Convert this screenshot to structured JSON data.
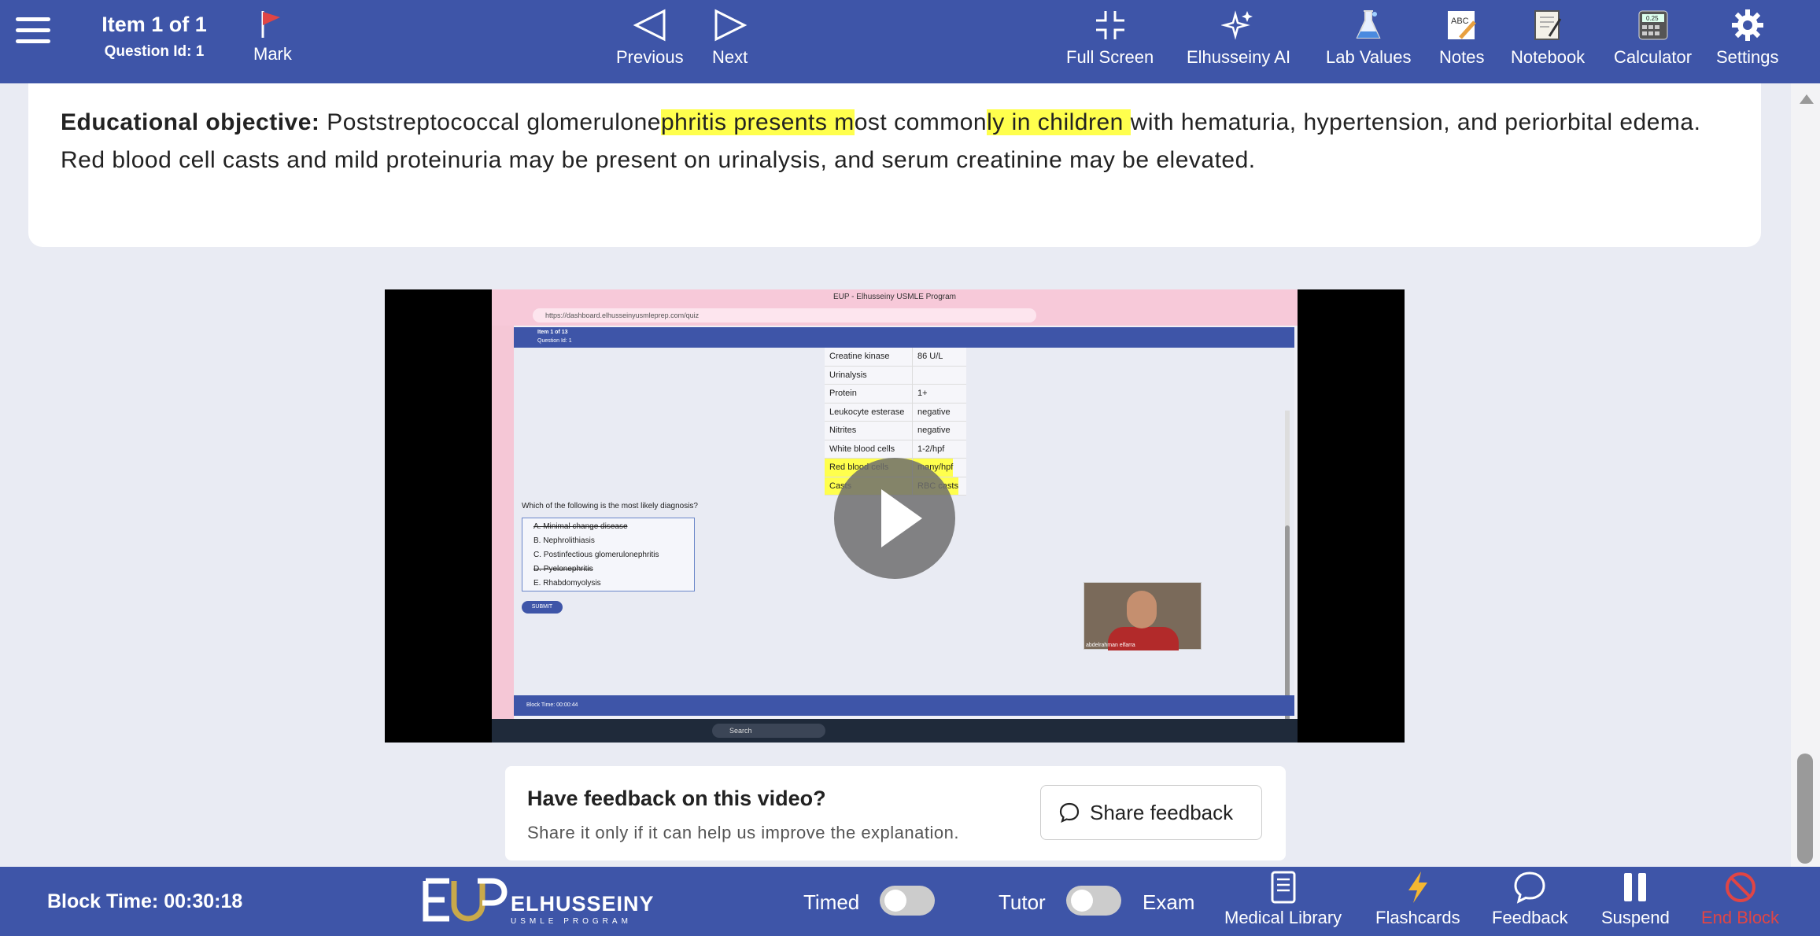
{
  "topbar": {
    "item_label": "Item 1 of 1",
    "question_id": "Question Id: 1",
    "mark": "Mark",
    "previous": "Previous",
    "next": "Next",
    "full_screen": "Full Screen",
    "ai": "Elhusseiny AI",
    "lab_values": "Lab Values",
    "notes": "Notes",
    "notebook": "Notebook",
    "calculator": "Calculator",
    "calculator_display": "0.25",
    "notes_icon_text": "ABC",
    "settings": "Settings"
  },
  "objective": {
    "label": "Educational objective:",
    "part1": " Poststreptococcal glomerulone",
    "hl1": "phritis presents m",
    "part2": "ost common",
    "hl2": "ly in children ",
    "part3": "with hematuria, hypertension, and periorbital edema.  Red blood cell casts and mild proteinuria may be present on urinalysis, and serum creatinine may be elevated."
  },
  "video": {
    "window_title": "EUP - Elhusseiny USMLE Program",
    "url": "https://dashboard.elhusseinyusmleprep.com/quiz",
    "app_item": "Item 1 of 13",
    "app_qid": "Question Id: 1",
    "lab_rows": [
      {
        "name": "Creatine kinase",
        "value": "86 U/L"
      },
      {
        "name": "Urinalysis",
        "value": ""
      },
      {
        "name": "Protein",
        "value": "1+"
      },
      {
        "name": "Leukocyte esterase",
        "value": "negative"
      },
      {
        "name": "Nitrites",
        "value": "negative"
      },
      {
        "name": "White blood cells",
        "value": "1-2/hpf"
      },
      {
        "name": "Red blood cells",
        "value": "many/hpf"
      },
      {
        "name": "Casts",
        "value": "RBC casts"
      }
    ],
    "question": "Which of the following is the most likely diagnosis?",
    "choices": [
      "A. Minimal change disease",
      "B. Nephrolithiasis",
      "C. Postinfectious glomerulonephritis",
      "D. Pyelonephritis",
      "E. Rhabdomyolysis"
    ],
    "submit": "SUBMIT",
    "webcam_name": "abdelrahman elfarra",
    "block_time": "Block Time: 00:00:44",
    "taskbar_search": "Search"
  },
  "feedback": {
    "title": "Have feedback on this video?",
    "subtitle": "Share it only if it can help us improve the explanation.",
    "button": "Share feedback"
  },
  "bottombar": {
    "block_time": "Block Time: 00:30:18",
    "logo_text": "ELHUSSEINY",
    "logo_sub": "USMLE PROGRAM",
    "timed": "Timed",
    "tutor": "Tutor",
    "exam": "Exam",
    "medical_library": "Medical Library",
    "flashcards": "Flashcards",
    "feedback": "Feedback",
    "suspend": "Suspend",
    "end_block": "End Block"
  },
  "colors": {
    "bar": "#3e55a8",
    "highlight": "#ffff4d",
    "end_block": "#e04545",
    "flashcards": "#f5b731"
  }
}
